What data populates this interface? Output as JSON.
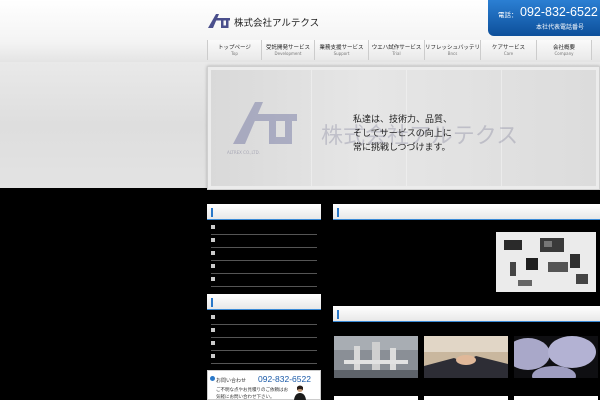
{
  "brand": {
    "name": "株式会社アルテクス",
    "logo_tagline": "ALTREX CO.,LTD."
  },
  "phone": {
    "label": "電話：",
    "number": "092-832-6522",
    "sub": "本社代表電話番号"
  },
  "nav": [
    {
      "jp": "トップページ",
      "en": "Top"
    },
    {
      "jp": "受託開発サービス",
      "en": "Development"
    },
    {
      "jp": "業務支援サービス",
      "en": "Support"
    },
    {
      "jp": "ウエハ試作サービス",
      "en": "Trial"
    },
    {
      "jp": "リフレッシュバッテリー",
      "en": "Bncs"
    },
    {
      "jp": "ケアサービス",
      "en": "Care"
    },
    {
      "jp": "会社概要",
      "en": "Company"
    }
  ],
  "hero": {
    "watermark_brand": "株式会社アルテクス",
    "watermark_tagline": "ALTREX CO.,LTD.",
    "lines": [
      "私達は、技術力、品質、",
      "そしてサービスの向上に",
      "常に挑戦しつづけます。"
    ]
  },
  "contact": {
    "label": "お問い合わせ",
    "phone": "092-832-6522",
    "text": "ご不明な点やお見積りのご依頼はお気軽にお問い合わせ下さい。"
  },
  "colors": {
    "accent": "#2a78c8",
    "phone_box": "#1a64b5"
  }
}
